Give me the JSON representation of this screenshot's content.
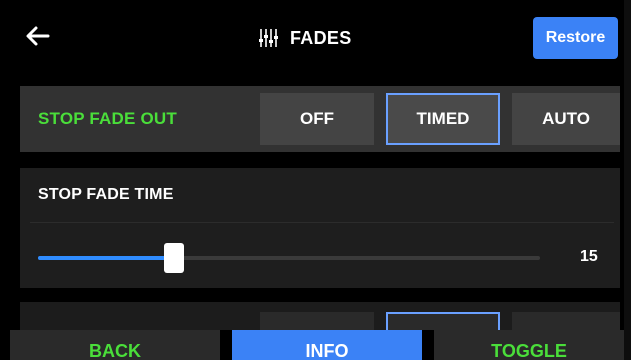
{
  "header": {
    "title": "FADES",
    "restore_label": "Restore",
    "back_icon": "arrow-left-icon",
    "title_icon": "fader-sliders-icon"
  },
  "stop_fade_out": {
    "label": "STOP FADE OUT",
    "options": [
      "OFF",
      "TIMED",
      "AUTO"
    ],
    "selected": "TIMED"
  },
  "stop_fade_time": {
    "label": "STOP FADE TIME",
    "value": "15",
    "slider_fraction": 0.27
  },
  "bottom_nav": {
    "back": "BACK",
    "info": "INFO",
    "toggle": "TOGGLE"
  },
  "colors": {
    "accent_blue": "#3b82f6",
    "label_green": "#4ade3a",
    "selected_border": "#6aa0ff"
  }
}
